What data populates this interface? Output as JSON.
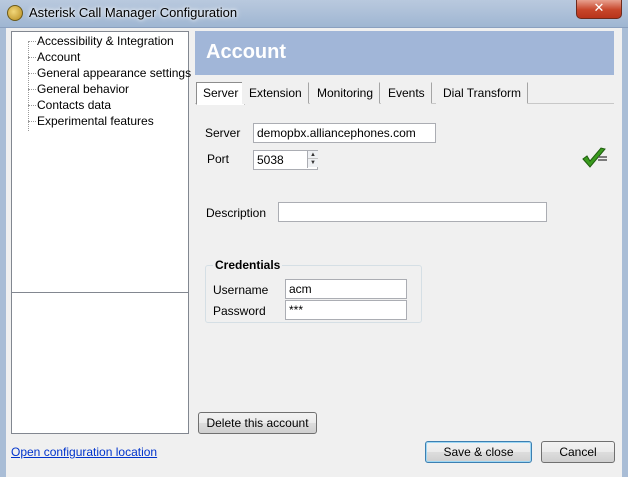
{
  "window": {
    "title": "Asterisk Call Manager Configuration",
    "close_glyph": "✕"
  },
  "sidebar": {
    "items": [
      {
        "label": "Accessibility & Integration"
      },
      {
        "label": "Account"
      },
      {
        "label": "General appearance settings"
      },
      {
        "label": "General behavior"
      },
      {
        "label": "Contacts data"
      },
      {
        "label": "Experimental features"
      }
    ]
  },
  "header": {
    "title": "Account"
  },
  "tabs": [
    {
      "label": "Server",
      "active": true
    },
    {
      "label": "Extension",
      "active": false
    },
    {
      "label": "Monitoring",
      "active": false
    },
    {
      "label": "Events",
      "active": false
    },
    {
      "label": "Dial Transform",
      "active": false
    }
  ],
  "server_tab": {
    "server_label": "Server",
    "server_value": "demopbx.alliancephones.com",
    "port_label": "Port",
    "port_value": "5038",
    "description_label": "Description",
    "description_value": "",
    "status_icon": "check-icon",
    "status_color": "#3a9b1e"
  },
  "credentials": {
    "title": "Credentials",
    "username_label": "Username",
    "username_value": "acm",
    "password_label": "Password",
    "password_value": "***"
  },
  "actions": {
    "delete_label": "Delete this account",
    "save_label": "Save & close",
    "cancel_label": "Cancel",
    "open_location_label": "Open configuration location"
  },
  "colors": {
    "header_bg": "#a1b6d8",
    "link": "#0033cc"
  }
}
